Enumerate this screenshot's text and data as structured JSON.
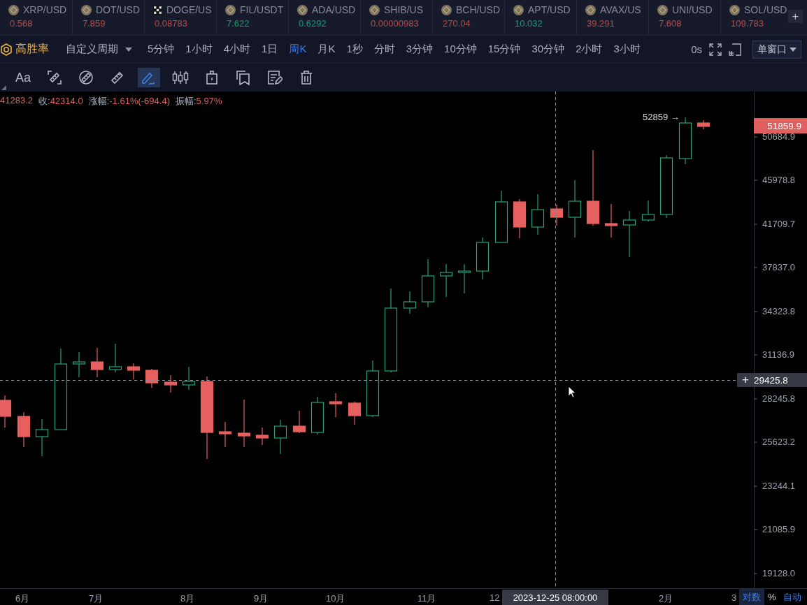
{
  "tickers": [
    {
      "kind": "coin",
      "name": "XRP/USD",
      "price": "0.568",
      "color": "#b84a4a"
    },
    {
      "kind": "coin",
      "name": "DOT/USD",
      "price": "7.859",
      "color": "#b84a4a"
    },
    {
      "kind": "checker",
      "name": "DOGE/US",
      "price": "0.08783",
      "color": "#b84a4a"
    },
    {
      "kind": "coin",
      "name": "FIL/USDT",
      "price": "7.622",
      "color": "#1c9c76"
    },
    {
      "kind": "coin",
      "name": "ADA/USD",
      "price": "0.6292",
      "color": "#1c9c76"
    },
    {
      "kind": "coin",
      "name": "SHIB/US",
      "price": "0.00000983",
      "color": "#b84a4a"
    },
    {
      "kind": "coin",
      "name": "BCH/USD",
      "price": "270.04",
      "color": "#b84a4a"
    },
    {
      "kind": "coin",
      "name": "APT/USD",
      "price": "10.032",
      "color": "#1c9c76"
    },
    {
      "kind": "coin",
      "name": "AVAX/US",
      "price": "39.291",
      "color": "#b84a4a"
    },
    {
      "kind": "coin",
      "name": "UNI/USD",
      "price": "7.608",
      "color": "#b84a4a"
    },
    {
      "kind": "coin",
      "name": "SOL/USD",
      "price": "109.783",
      "color": "#b84a4a"
    }
  ],
  "add_button": "+",
  "strategy": "高胜率",
  "custom_period": "自定义周期",
  "intervals": [
    {
      "label": "5分钟",
      "selected": false
    },
    {
      "label": "1小时",
      "selected": false
    },
    {
      "label": "4小时",
      "selected": false
    },
    {
      "label": "1日",
      "selected": false
    },
    {
      "label": "周K",
      "selected": true
    },
    {
      "label": "月K",
      "selected": false
    },
    {
      "label": "1秒",
      "selected": false
    },
    {
      "label": "分时",
      "selected": false
    },
    {
      "label": "3分钟",
      "selected": false
    },
    {
      "label": "10分钟",
      "selected": false
    },
    {
      "label": "15分钟",
      "selected": false
    },
    {
      "label": "30分钟",
      "selected": false
    },
    {
      "label": "2小时",
      "selected": false
    },
    {
      "label": "3小时",
      "selected": false
    }
  ],
  "countdown": "0s",
  "window_mode": "单窗口",
  "tools": [
    {
      "kind": "text",
      "label": "Aa",
      "selected": false
    },
    {
      "kind": "ruler-bracket",
      "selected": false
    },
    {
      "kind": "ruler-cross",
      "selected": false
    },
    {
      "kind": "ruler",
      "selected": false
    },
    {
      "kind": "pen-wave",
      "selected": true
    },
    {
      "kind": "candles",
      "selected": false
    },
    {
      "kind": "lock",
      "selected": false
    },
    {
      "kind": "bookmark",
      "selected": false
    },
    {
      "kind": "note",
      "selected": false
    },
    {
      "kind": "trash",
      "selected": false
    }
  ],
  "ohlc_info": [
    {
      "value": "41283.2"
    },
    {
      "label": "收:",
      "value": "42314.0"
    },
    {
      "label": "涨幅:",
      "value": "-1.61%(-694.4)"
    },
    {
      "label": "振幅:",
      "value": "5.97%"
    }
  ],
  "high_marker": "52859 →",
  "price_axis": {
    "labels": [
      "50684.9",
      "45978.8",
      "41709.7",
      "37837.0",
      "34323.8",
      "31136.9",
      "28245.8",
      "25623.2",
      "23244.1",
      "21085.9",
      "19128.0"
    ],
    "last_price": "51859.9",
    "crosshair_price": "29425.8",
    "crosshair_plus": "+"
  },
  "time_axis": {
    "labels": [
      "6月",
      "7月",
      "8月",
      "9月",
      "10月",
      "11月",
      "12",
      "2月",
      "3"
    ],
    "crosshair_time": "2023-12-25 08:00:00"
  },
  "scale_options": [
    {
      "label": "对数",
      "selected": true
    },
    {
      "label": "%",
      "selected": false
    },
    {
      "label": "自动",
      "selected": true
    }
  ]
}
